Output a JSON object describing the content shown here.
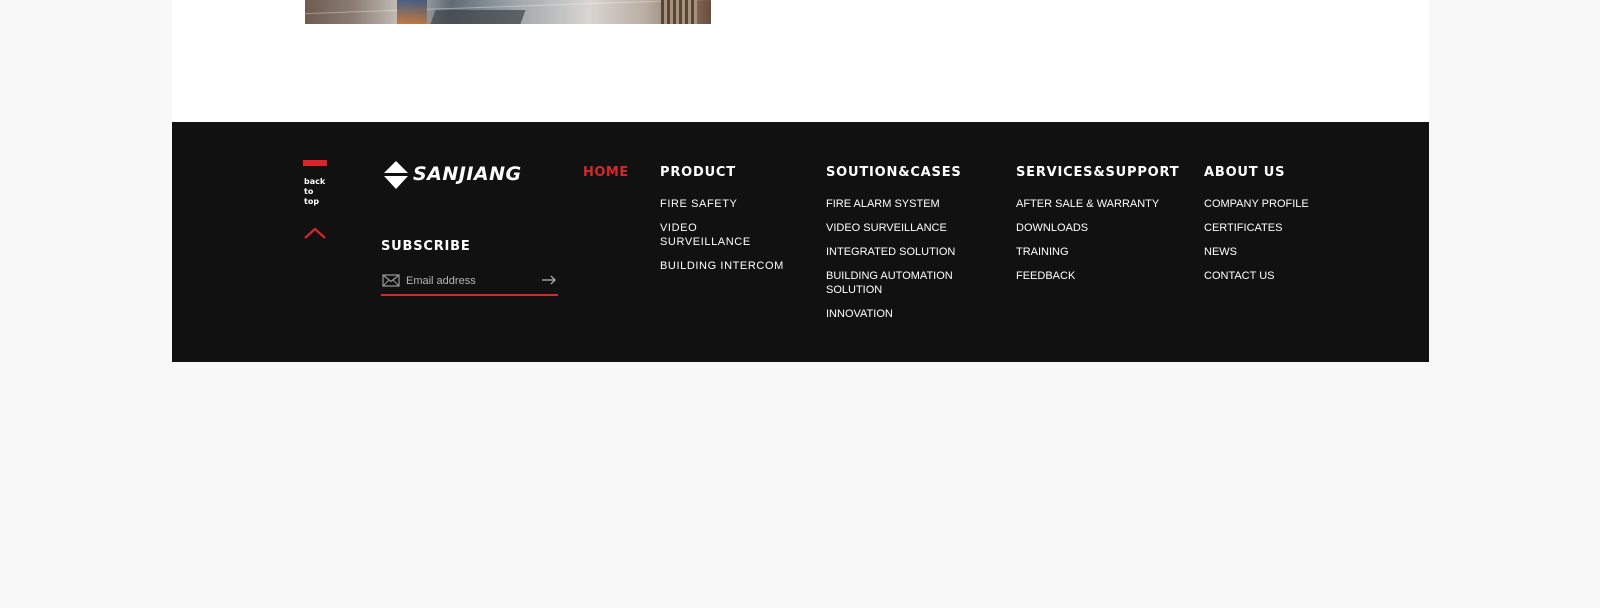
{
  "back_to_top": {
    "label_lines": [
      "back",
      "to",
      "top"
    ]
  },
  "brand": {
    "logo_text": "SANJIANG"
  },
  "subscribe": {
    "title": "SUBSCRIBE",
    "placeholder": "Email address"
  },
  "nav": {
    "home_label": "HOME",
    "columns": [
      {
        "title": "PRODUCT",
        "items": [
          "FIRE SAFETY",
          "VIDEO SURVEILLANCE",
          "BUILDING INTERCOM"
        ]
      },
      {
        "title": "SOUTION&CASES",
        "items": [
          "FIRE ALARM SYSTEM",
          "VIDEO SURVEILLANCE",
          "INTEGRATED SOLUTION",
          "BUILDING AUTOMATION SOLUTION",
          "INNOVATION"
        ]
      },
      {
        "title": "SERVICES&SUPPORT",
        "items": [
          "AFTER SALE & WARRANTY",
          "DOWNLOADS",
          "TRAINING",
          "FEEDBACK"
        ]
      },
      {
        "title": "ABOUT US",
        "items": [
          "COMPANY PROFILE",
          "CERTIFICATES",
          "NEWS",
          "CONTACT US"
        ]
      }
    ]
  },
  "colors": {
    "accent": "#d8262c",
    "footer_bg": "#111111",
    "page_bg": "#f8f8f8",
    "content_bg": "#ffffff"
  },
  "icons": {
    "logo_mark": "diamond-logo-icon",
    "mail": "mail-icon",
    "submit": "arrow-right-icon",
    "back_to_top": "chevron-up-icon"
  }
}
